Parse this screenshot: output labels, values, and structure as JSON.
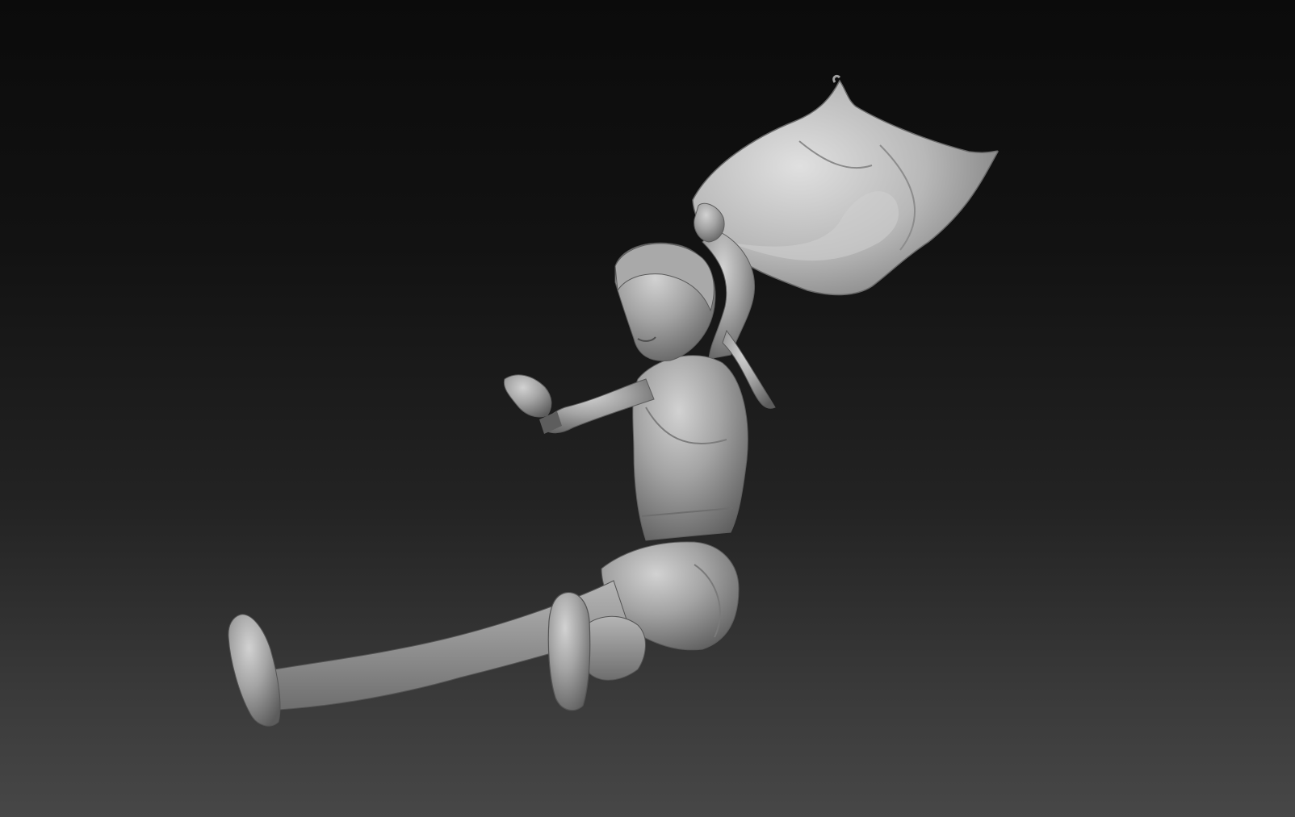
{
  "viewport": {
    "background_top": "#0b0b0b",
    "background_bottom": "#474747",
    "model_color": "#9a9a9a",
    "model_highlight": "#c9c9c9",
    "model_shadow": "#5a5a5a"
  }
}
